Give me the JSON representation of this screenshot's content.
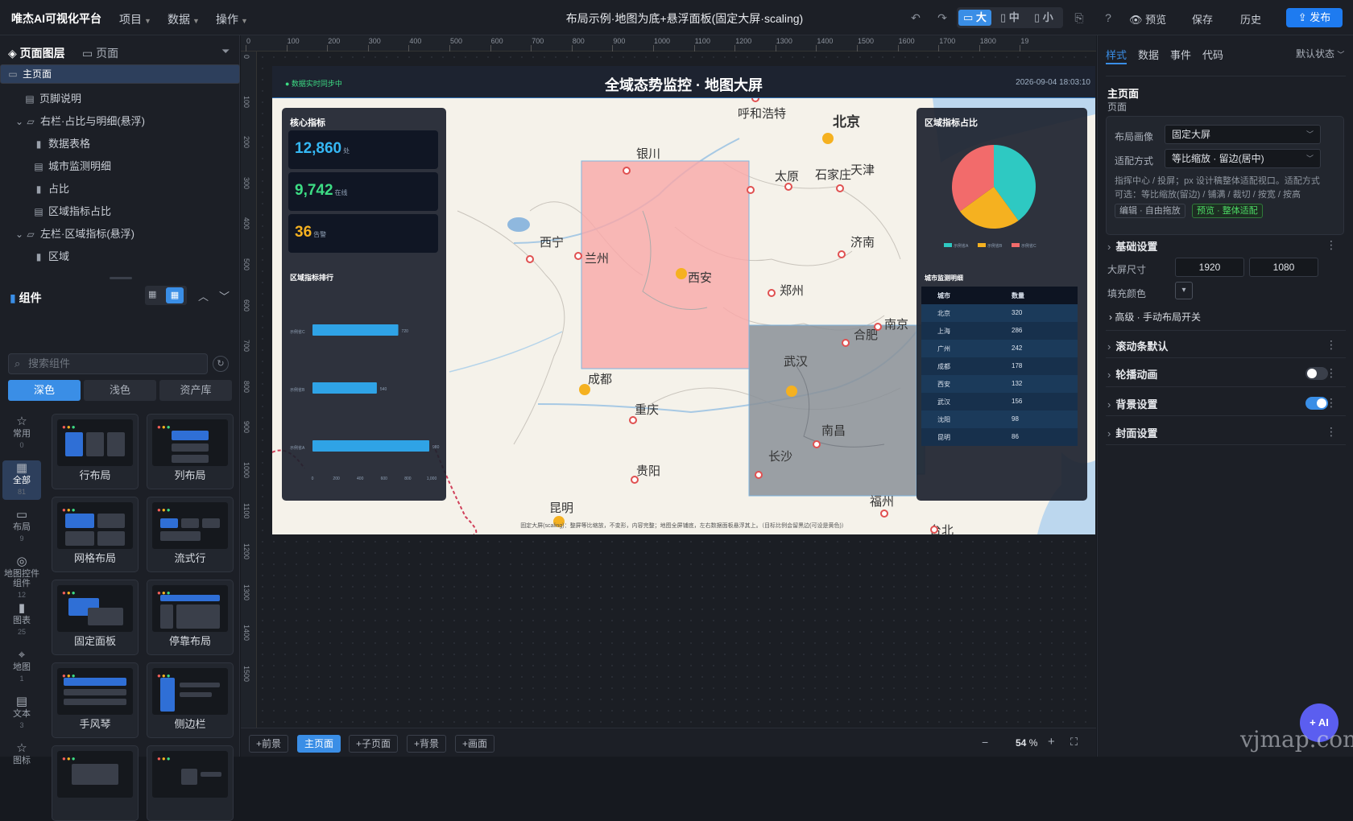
{
  "app": {
    "logo": "唯杰AI可视化平台",
    "menus": [
      "项目",
      "数据",
      "操作"
    ],
    "doc_title": "布局示例·地图为底+悬浮面板(固定大屏·scaling)",
    "device_modes": [
      "大",
      "中",
      "小"
    ],
    "preview": "预览",
    "save": "保存",
    "history": "历史",
    "publish": "发布"
  },
  "left": {
    "tabs": [
      "页面图层",
      "页面"
    ],
    "tree": [
      {
        "label": "主页面",
        "icon": "monitor-icon",
        "indent": 0
      },
      {
        "label": "页脚说明",
        "icon": "doc-icon",
        "indent": 2
      },
      {
        "label": "右栏·占比与明细(悬浮)",
        "icon": "folder-icon",
        "indent": 1
      },
      {
        "label": "数据表格",
        "icon": "bar-icon",
        "indent": 3
      },
      {
        "label": "城市监测明细",
        "icon": "doc-icon",
        "indent": 3
      },
      {
        "label": "占比",
        "icon": "bar-icon",
        "indent": 3
      },
      {
        "label": "区域指标占比",
        "icon": "doc-icon",
        "indent": 3
      },
      {
        "label": "左栏·区域指标(悬浮)",
        "icon": "folder-icon",
        "indent": 1
      },
      {
        "label": "区域",
        "icon": "bar-icon",
        "indent": 3
      }
    ],
    "components_title": "组件",
    "search_placeholder": "搜索组件",
    "themes": [
      "深色",
      "浅色",
      "资产库"
    ],
    "categories": [
      {
        "label": "常用",
        "count": "0"
      },
      {
        "label": "全部",
        "count": "81"
      },
      {
        "label": "布局",
        "count": "9"
      },
      {
        "label": "地图控件组件",
        "count": "12"
      },
      {
        "label": "图表",
        "count": "25"
      },
      {
        "label": "地图",
        "count": "1"
      },
      {
        "label": "文本",
        "count": "3"
      },
      {
        "label": "图标",
        "count": ""
      }
    ],
    "cards": [
      "行布局",
      "列布局",
      "网格布局",
      "流式行",
      "固定面板",
      "停靠布局",
      "手风琴",
      "侧边栏",
      "",
      ""
    ]
  },
  "ruler": {
    "h": [
      "0",
      "100",
      "200",
      "300",
      "400",
      "500",
      "600",
      "700",
      "800",
      "900",
      "1000",
      "1100",
      "1200",
      "1300",
      "1400",
      "1500",
      "1600",
      "1700",
      "1800",
      "19"
    ],
    "v": [
      "0",
      "100",
      "200",
      "300",
      "400",
      "500",
      "600",
      "700",
      "800",
      "900",
      "1000",
      "1100",
      "1200",
      "1300",
      "1400",
      "1500"
    ]
  },
  "dashboard": {
    "live": "● 数据实时同步中",
    "title": "全域态势监控 · 地图大屏",
    "datetime": "2026-09-04 18:03:10",
    "kpi_title": "核心指标",
    "kpis": [
      {
        "value": "12,860",
        "unit": "处",
        "color": "#35b8f5"
      },
      {
        "value": "9,742",
        "unit": "在线",
        "color": "#3ddc84"
      },
      {
        "value": "36",
        "unit": "告警",
        "color": "#f5b120"
      }
    ],
    "rank_title": "区域指标排行",
    "share_title": "区域指标占比",
    "detail_title": "城市监测明细",
    "footer_note": "固定大屏(scaling)：整屏等比缩放，不变形，内容完整；地图全屏铺底，左右数据面板悬浮其上。（目标比例会留黑边(可设是黄色)）",
    "cities": [
      "呼和浩特",
      "北京",
      "银川",
      "太原",
      "石家庄",
      "天津",
      "西宁",
      "济南",
      "兰州",
      "西安",
      "郑州",
      "合肥",
      "南京",
      "武汉",
      "成都",
      "重庆",
      "南昌",
      "长沙",
      "贵阳",
      "福州",
      "昆明",
      "台北"
    ]
  },
  "chart_data": [
    {
      "type": "bar",
      "title": "区域指标排行",
      "categories": [
        "示例省C",
        "示例省B",
        "示例省A"
      ],
      "values": [
        720,
        540,
        980
      ],
      "xlim": [
        0,
        1000
      ],
      "xticks": [
        "0",
        "200",
        "400",
        "600",
        "800",
        "1,000"
      ],
      "orientation": "horizontal"
    },
    {
      "type": "pie",
      "title": "区域指标占比",
      "series": [
        {
          "name": "示例省A",
          "value": 40,
          "color": "#2ec9c2"
        },
        {
          "name": "示例省B",
          "value": 25,
          "color": "#f5b120"
        },
        {
          "name": "示例省C",
          "value": 35,
          "color": "#f26b6b"
        }
      ]
    },
    {
      "type": "table",
      "title": "城市监测明细",
      "columns": [
        "城市",
        "数量"
      ],
      "rows": [
        [
          "北京",
          "320"
        ],
        [
          "上海",
          "286"
        ],
        [
          "广州",
          "242"
        ],
        [
          "成都",
          "178"
        ],
        [
          "西安",
          "132"
        ],
        [
          "武汉",
          "156"
        ],
        [
          "沈阳",
          "98"
        ],
        [
          "昆明",
          "86"
        ]
      ]
    }
  ],
  "bottom": {
    "buttons": [
      "+前景",
      "主页面",
      "+子页面",
      "+背景",
      "+画面"
    ],
    "zoom": "54",
    "zoom_unit": "%"
  },
  "right": {
    "tabs": [
      "样式",
      "数据",
      "事件",
      "代码"
    ],
    "state": "默认状态",
    "page_name": "主页面",
    "page_type": "页面",
    "layout_label": "布局画像",
    "layout_value": "固定大屏",
    "fit_label": "适配方式",
    "fit_value": "等比缩放 · 留边(居中)",
    "desc": "指挥中心 / 投屏；px 设计稿整体适配视口。适配方式可选：等比缩放(留边) / 铺满 / 裁切 / 按宽 / 按高",
    "tag_edit": "编辑 · 自由拖放",
    "tag_preview": "预览 · 整体适配",
    "basic": "基础设置",
    "size_label": "大屏尺寸",
    "width": "1920",
    "height": "1080",
    "fill_label": "填充颜色",
    "advanced": "高级 · 手动布局开关",
    "sections": [
      "滚动条默认",
      "轮播动画",
      "背景设置",
      "封面设置"
    ]
  },
  "ai_label": "+ AI",
  "watermark": "vjmap.com"
}
